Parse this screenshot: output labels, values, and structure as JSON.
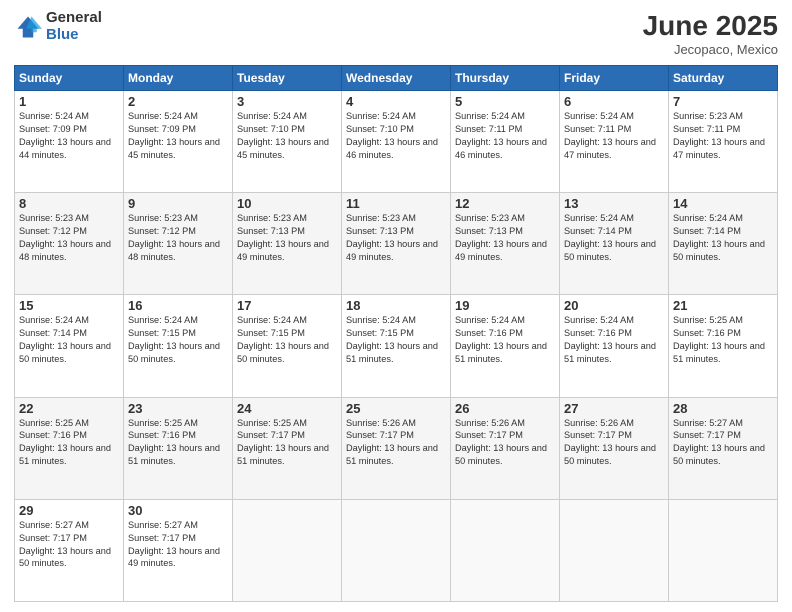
{
  "logo": {
    "general": "General",
    "blue": "Blue"
  },
  "header": {
    "month": "June 2025",
    "location": "Jecopaco, Mexico"
  },
  "weekdays": [
    "Sunday",
    "Monday",
    "Tuesday",
    "Wednesday",
    "Thursday",
    "Friday",
    "Saturday"
  ],
  "weeks": [
    [
      {
        "day": 1,
        "sunrise": "5:24 AM",
        "sunset": "7:09 PM",
        "daylight": "13 hours and 44 minutes."
      },
      {
        "day": 2,
        "sunrise": "5:24 AM",
        "sunset": "7:09 PM",
        "daylight": "13 hours and 45 minutes."
      },
      {
        "day": 3,
        "sunrise": "5:24 AM",
        "sunset": "7:10 PM",
        "daylight": "13 hours and 45 minutes."
      },
      {
        "day": 4,
        "sunrise": "5:24 AM",
        "sunset": "7:10 PM",
        "daylight": "13 hours and 46 minutes."
      },
      {
        "day": 5,
        "sunrise": "5:24 AM",
        "sunset": "7:11 PM",
        "daylight": "13 hours and 46 minutes."
      },
      {
        "day": 6,
        "sunrise": "5:24 AM",
        "sunset": "7:11 PM",
        "daylight": "13 hours and 47 minutes."
      },
      {
        "day": 7,
        "sunrise": "5:23 AM",
        "sunset": "7:11 PM",
        "daylight": "13 hours and 47 minutes."
      }
    ],
    [
      {
        "day": 8,
        "sunrise": "5:23 AM",
        "sunset": "7:12 PM",
        "daylight": "13 hours and 48 minutes."
      },
      {
        "day": 9,
        "sunrise": "5:23 AM",
        "sunset": "7:12 PM",
        "daylight": "13 hours and 48 minutes."
      },
      {
        "day": 10,
        "sunrise": "5:23 AM",
        "sunset": "7:13 PM",
        "daylight": "13 hours and 49 minutes."
      },
      {
        "day": 11,
        "sunrise": "5:23 AM",
        "sunset": "7:13 PM",
        "daylight": "13 hours and 49 minutes."
      },
      {
        "day": 12,
        "sunrise": "5:23 AM",
        "sunset": "7:13 PM",
        "daylight": "13 hours and 49 minutes."
      },
      {
        "day": 13,
        "sunrise": "5:24 AM",
        "sunset": "7:14 PM",
        "daylight": "13 hours and 50 minutes."
      },
      {
        "day": 14,
        "sunrise": "5:24 AM",
        "sunset": "7:14 PM",
        "daylight": "13 hours and 50 minutes."
      }
    ],
    [
      {
        "day": 15,
        "sunrise": "5:24 AM",
        "sunset": "7:14 PM",
        "daylight": "13 hours and 50 minutes."
      },
      {
        "day": 16,
        "sunrise": "5:24 AM",
        "sunset": "7:15 PM",
        "daylight": "13 hours and 50 minutes."
      },
      {
        "day": 17,
        "sunrise": "5:24 AM",
        "sunset": "7:15 PM",
        "daylight": "13 hours and 50 minutes."
      },
      {
        "day": 18,
        "sunrise": "5:24 AM",
        "sunset": "7:15 PM",
        "daylight": "13 hours and 51 minutes."
      },
      {
        "day": 19,
        "sunrise": "5:24 AM",
        "sunset": "7:16 PM",
        "daylight": "13 hours and 51 minutes."
      },
      {
        "day": 20,
        "sunrise": "5:24 AM",
        "sunset": "7:16 PM",
        "daylight": "13 hours and 51 minutes."
      },
      {
        "day": 21,
        "sunrise": "5:25 AM",
        "sunset": "7:16 PM",
        "daylight": "13 hours and 51 minutes."
      }
    ],
    [
      {
        "day": 22,
        "sunrise": "5:25 AM",
        "sunset": "7:16 PM",
        "daylight": "13 hours and 51 minutes."
      },
      {
        "day": 23,
        "sunrise": "5:25 AM",
        "sunset": "7:16 PM",
        "daylight": "13 hours and 51 minutes."
      },
      {
        "day": 24,
        "sunrise": "5:25 AM",
        "sunset": "7:17 PM",
        "daylight": "13 hours and 51 minutes."
      },
      {
        "day": 25,
        "sunrise": "5:26 AM",
        "sunset": "7:17 PM",
        "daylight": "13 hours and 51 minutes."
      },
      {
        "day": 26,
        "sunrise": "5:26 AM",
        "sunset": "7:17 PM",
        "daylight": "13 hours and 50 minutes."
      },
      {
        "day": 27,
        "sunrise": "5:26 AM",
        "sunset": "7:17 PM",
        "daylight": "13 hours and 50 minutes."
      },
      {
        "day": 28,
        "sunrise": "5:27 AM",
        "sunset": "7:17 PM",
        "daylight": "13 hours and 50 minutes."
      }
    ],
    [
      {
        "day": 29,
        "sunrise": "5:27 AM",
        "sunset": "7:17 PM",
        "daylight": "13 hours and 50 minutes."
      },
      {
        "day": 30,
        "sunrise": "5:27 AM",
        "sunset": "7:17 PM",
        "daylight": "13 hours and 49 minutes."
      },
      null,
      null,
      null,
      null,
      null
    ]
  ]
}
